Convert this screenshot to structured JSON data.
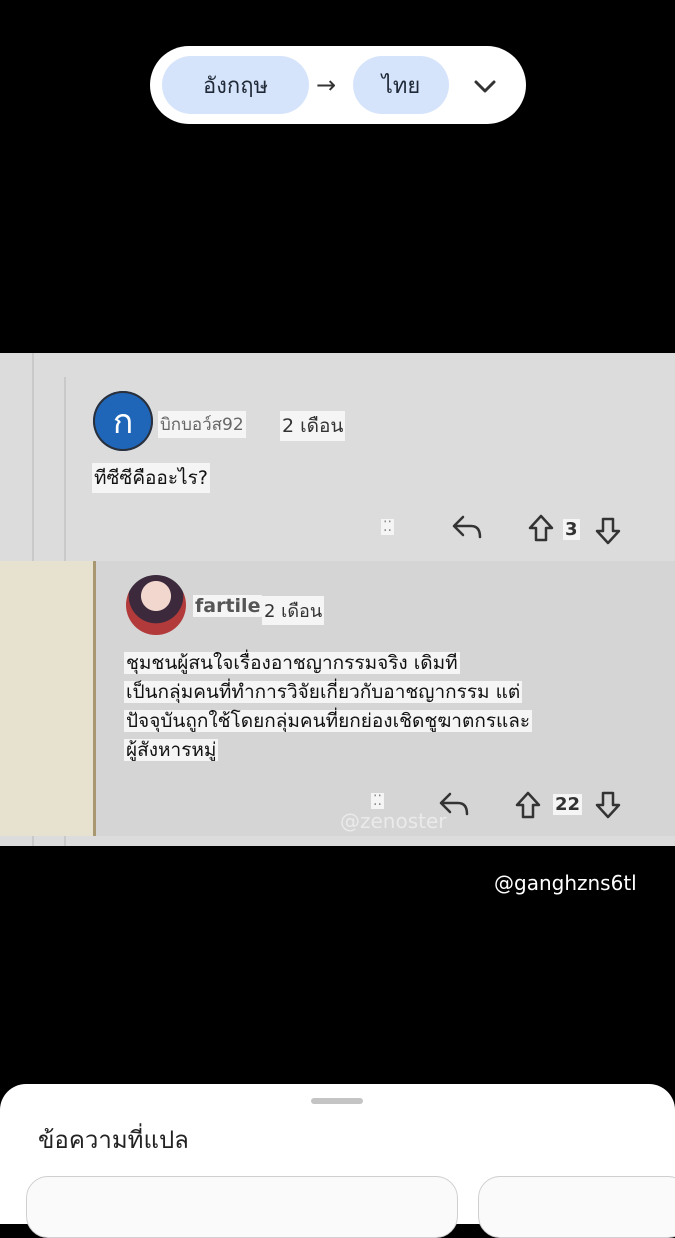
{
  "translator": {
    "source_lang": "อังกฤษ",
    "target_lang": "ไทย",
    "arrow": "→"
  },
  "comment1": {
    "avatar_letter": "ก",
    "username": "บิกบอว์ส92",
    "time": "2 เดือน",
    "text": "ทีซีซีคืออะไร?",
    "votes": "3"
  },
  "comment2": {
    "username": "fartile",
    "time": "2 เดือน",
    "lines": [
      "ชุมชนผู้สนใจเรื่องอาชญากรรมจริง เดิมที",
      "เป็นกลุ่มคนที่ทำการวิจัยเกี่ยวกับอาชญากรรม แต่",
      "ปัจจุบันถูกใช้โดยกลุ่มคนที่ยกย่องเชิดชูฆาตกรและ",
      "ผู้สังหารหมู่"
    ],
    "votes": "22"
  },
  "watermarks": {
    "video": "@zenoster",
    "tiktok": "@ganghzns6tl"
  },
  "sheet": {
    "title": "ข้อความที่แปล"
  },
  "colors": {
    "chip": "#d6e4fb",
    "panel": "#dcdcdc",
    "avatar": "#1f66b8",
    "reply_bar": "#a89770"
  }
}
